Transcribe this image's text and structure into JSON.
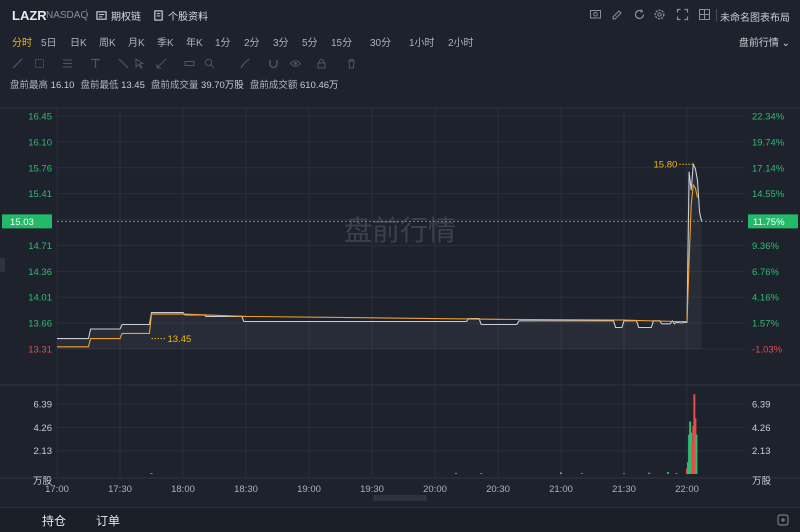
{
  "header": {
    "ticker": "LAZR",
    "exchange": "NASDAQ",
    "options_label": "期权链",
    "profile_label": "个股资料",
    "layout_name": "未命名图表布局"
  },
  "periods": [
    {
      "label": "分时",
      "active": true
    },
    {
      "label": "5日"
    },
    {
      "label": "日K"
    },
    {
      "label": "周K"
    },
    {
      "label": "月K"
    },
    {
      "label": "季K"
    },
    {
      "label": "年K"
    },
    {
      "label": "1分"
    },
    {
      "label": "2分"
    },
    {
      "label": "3分"
    },
    {
      "label": "5分"
    },
    {
      "label": "15分"
    },
    {
      "label": "30分"
    },
    {
      "label": "1小时"
    },
    {
      "label": "2小时"
    }
  ],
  "session_select": "盘前行情",
  "stats": {
    "high_label": "盘前最高",
    "high": "16.10",
    "low_label": "盘前最低",
    "low": "13.45",
    "vol_label": "盘前成交量",
    "vol": "39.70万股",
    "amt_label": "盘前成交额",
    "amt": "610.46万"
  },
  "watermark": "盘前行情",
  "bottom": {
    "holdings_label": "持仓",
    "orders_label": "订单"
  },
  "colors": {
    "up": "#2ebd6b",
    "down": "#e84b4b",
    "price_line": "#c8ccd3",
    "avg_line": "#f0a030",
    "highlight": "#22b968",
    "annotation": "#f0b90b"
  },
  "chart_data": {
    "type": "line",
    "ylim": [
      13.31,
      16.45
    ],
    "price_ticks": [
      "16.45",
      "16.10",
      "15.76",
      "15.41",
      "15.06",
      "14.71",
      "14.36",
      "14.01",
      "13.66",
      "13.31"
    ],
    "pct_ticks": [
      "22.34%",
      "19.74%",
      "17.14%",
      "14.55%",
      "11.75%",
      "9.36%",
      "6.76%",
      "4.16%",
      "1.57%",
      "-1.03%"
    ],
    "current_price": "15.03",
    "current_pct": "11.75%",
    "annotations": [
      {
        "label": "15.80",
        "x": "22:03",
        "y": 15.8
      },
      {
        "label": "13.45",
        "x": "17:45",
        "y": 13.45
      }
    ],
    "x_ticks": [
      "17:00",
      "17:30",
      "18:00",
      "18:30",
      "19:00",
      "19:30",
      "20:00",
      "20:30",
      "21:00",
      "21:30",
      "22:00"
    ],
    "series": [
      {
        "type": "price",
        "x": [
          "17:00",
          "17:15",
          "17:16",
          "17:30",
          "17:31",
          "17:44",
          "17:45",
          "18:00",
          "18:01",
          "18:10",
          "18:11",
          "18:28",
          "18:29",
          "20:15",
          "20:16",
          "20:21",
          "20:22",
          "20:39",
          "20:40",
          "21:25",
          "21:26",
          "21:29",
          "21:30",
          "21:36",
          "21:37",
          "21:43",
          "21:44",
          "21:47",
          "21:48",
          "21:52",
          "21:53",
          "21:54",
          "21:55",
          "21:57",
          "22:00",
          "22:01",
          "22:02",
          "22:03",
          "22:04",
          "22:05",
          "22:06",
          "22:07"
        ],
        "y": [
          13.45,
          13.45,
          13.58,
          13.58,
          13.64,
          13.64,
          13.8,
          13.8,
          13.77,
          13.77,
          13.75,
          13.75,
          13.68,
          13.68,
          13.72,
          13.72,
          13.64,
          13.64,
          13.69,
          13.69,
          13.6,
          13.6,
          13.69,
          13.69,
          13.6,
          13.6,
          13.69,
          13.69,
          13.65,
          13.65,
          13.69,
          13.65,
          13.67,
          13.66,
          13.67,
          15.7,
          15.45,
          15.8,
          15.74,
          15.58,
          15.15,
          15.03
        ]
      },
      {
        "type": "average",
        "x": [
          "17:00",
          "17:15",
          "17:16",
          "17:30",
          "17:31",
          "17:44",
          "17:45",
          "18:00",
          "18:30",
          "19:30",
          "20:30",
          "21:30",
          "21:55",
          "22:00",
          "22:01",
          "22:02",
          "22:03",
          "22:04",
          "22:05"
        ],
        "y": [
          13.34,
          13.34,
          13.45,
          13.45,
          13.52,
          13.52,
          13.78,
          13.78,
          13.75,
          13.73,
          13.71,
          13.7,
          13.68,
          13.68,
          14.5,
          15.25,
          15.52,
          15.48,
          15.35
        ]
      }
    ],
    "volume": {
      "ylim": [
        0,
        7.5
      ],
      "ticks": [
        "6.39",
        "4.26",
        "2.13"
      ],
      "unit": "万股",
      "bars": [
        {
          "x": "17:45",
          "v": 0.03,
          "dir": "up"
        },
        {
          "x": "20:10",
          "v": 0.05,
          "dir": "up"
        },
        {
          "x": "20:22",
          "v": 0.03,
          "dir": "down"
        },
        {
          "x": "21:00",
          "v": 0.15,
          "dir": "up"
        },
        {
          "x": "21:10",
          "v": 0.05,
          "dir": "down"
        },
        {
          "x": "21:30",
          "v": 0.05,
          "dir": "down"
        },
        {
          "x": "21:42",
          "v": 0.12,
          "dir": "up"
        },
        {
          "x": "21:51",
          "v": 0.18,
          "dir": "up"
        },
        {
          "x": "21:55",
          "v": 0.06,
          "dir": "down"
        },
        {
          "x": "22:00",
          "v": 0.5,
          "dir": "down"
        },
        {
          "x": "22:00.5",
          "v": 1.1,
          "dir": "up"
        },
        {
          "x": "22:01",
          "v": 3.6,
          "dir": "up"
        },
        {
          "x": "22:01.5",
          "v": 4.8,
          "dir": "up"
        },
        {
          "x": "22:02",
          "v": 3.8,
          "dir": "up"
        },
        {
          "x": "22:02.5",
          "v": 2.7,
          "dir": "down"
        },
        {
          "x": "22:03",
          "v": 4.4,
          "dir": "down"
        },
        {
          "x": "22:03.5",
          "v": 7.3,
          "dir": "down"
        },
        {
          "x": "22:04",
          "v": 5.1,
          "dir": "down"
        },
        {
          "x": "22:04.5",
          "v": 3.6,
          "dir": "up"
        }
      ]
    }
  }
}
